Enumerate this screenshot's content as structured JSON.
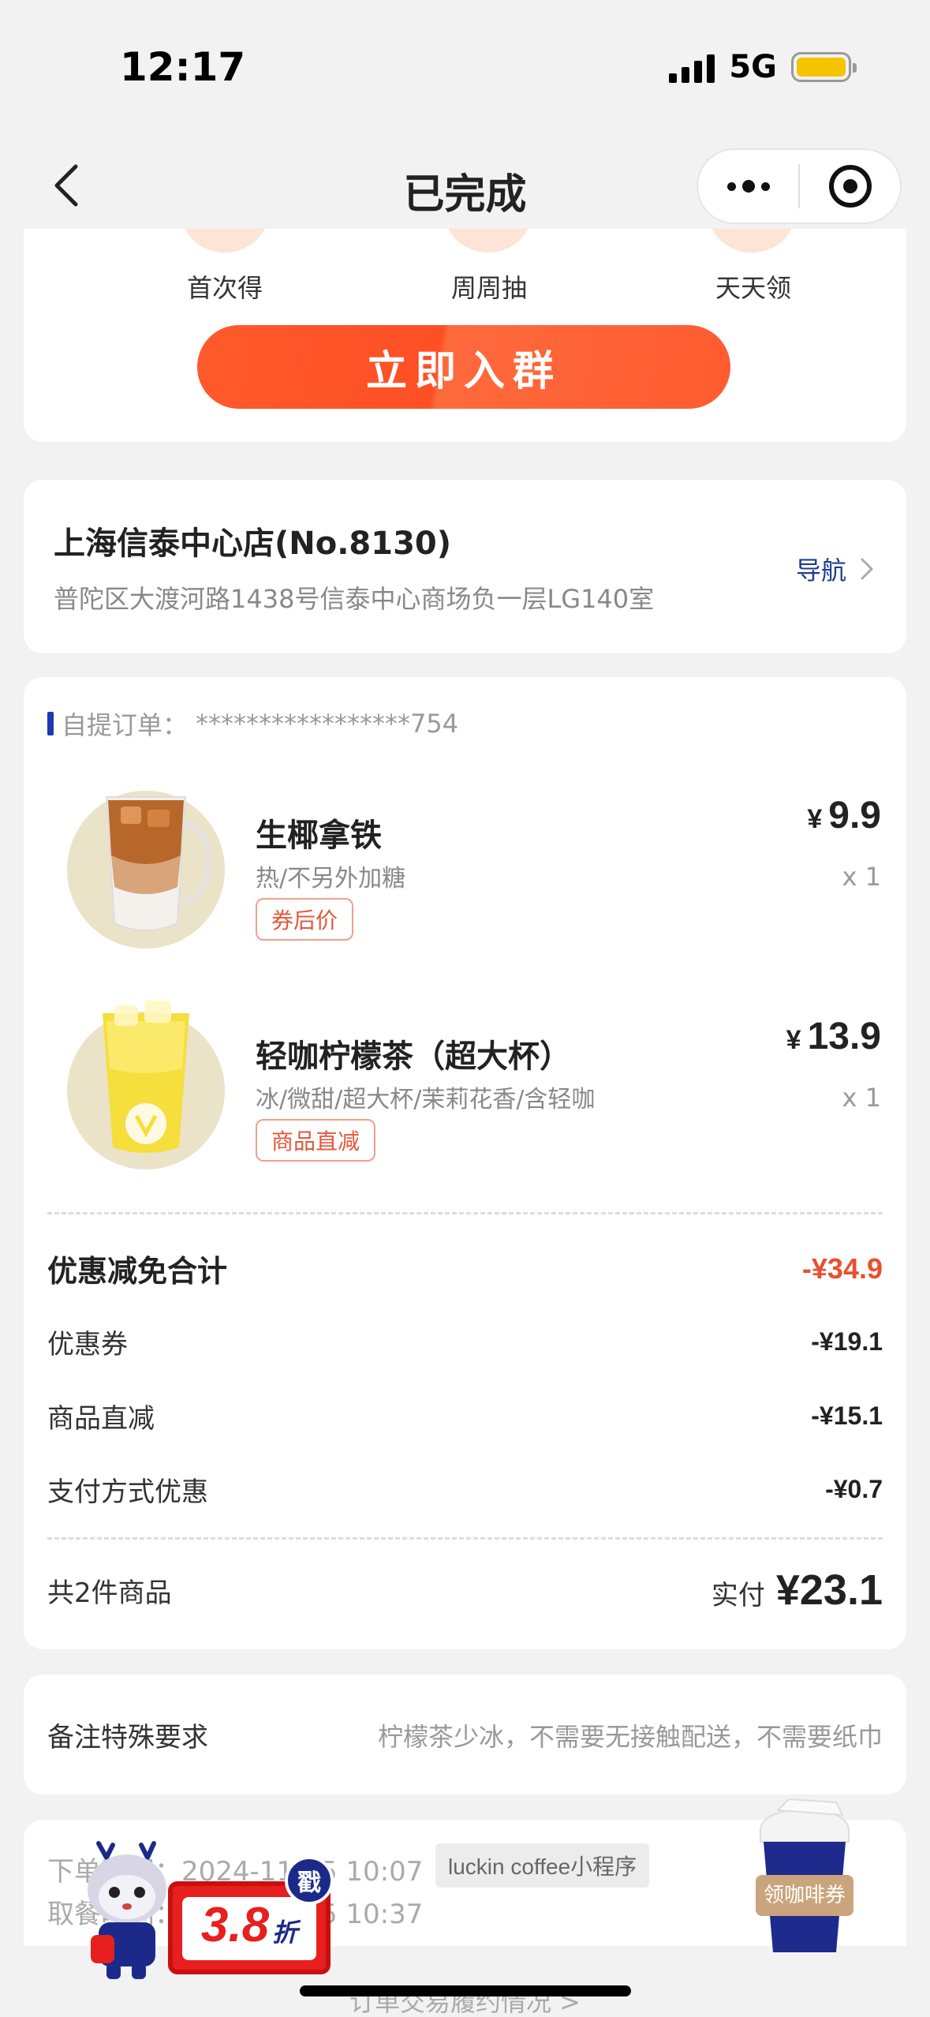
{
  "status_bar": {
    "time": "12:17",
    "network": "5G"
  },
  "nav": {
    "title": "已完成"
  },
  "group": {
    "perks": [
      "首次得",
      "周周抽",
      "天天领"
    ],
    "join_button": "立即入群"
  },
  "store": {
    "name": "上海信泰中心店(No.8130)",
    "address": "普陀区大渡河路1438号信泰中心商场负一层LG140室",
    "nav_label": "导航"
  },
  "order": {
    "type_label": "自提订单：",
    "order_id": "*****************754",
    "items": [
      {
        "name": "生椰拿铁",
        "spec": "热/不另外加糖",
        "tag": "券后价",
        "currency": "¥",
        "price": "9.9",
        "qty": "x 1"
      },
      {
        "name": "轻咖柠檬茶（超大杯）",
        "spec": "冰/微甜/超大杯/茉莉花香/含轻咖",
        "tag": "商品直减",
        "currency": "¥",
        "price": "13.9",
        "qty": "x 1"
      }
    ],
    "discount_total_label": "优惠减免合计",
    "discount_total": "-¥34.9",
    "discounts": [
      {
        "label": "优惠券",
        "value": "-¥19.1"
      },
      {
        "label": "商品直减",
        "value": "-¥15.1"
      },
      {
        "label": "支付方式优惠",
        "value": "-¥0.7"
      }
    ],
    "count_label": "共2件商品",
    "paid_label": "实付",
    "paid_value": "¥23.1"
  },
  "remark": {
    "label": "备注特殊要求",
    "text": "柠檬茶少冰，不需要无接触配送，不需要纸巾"
  },
  "info": {
    "order_time": "下单时间：2024-11-15 10:07",
    "pickup_time": "取餐时间：2024-11-15 10:37",
    "source_badge": "luckin coffee小程序",
    "bottom_link": "订单交易履约情况 >"
  },
  "promo": {
    "discount": "3.8",
    "unit": "折",
    "stamp": "戳"
  },
  "coupon_cup": {
    "label": "领咖啡券"
  }
}
